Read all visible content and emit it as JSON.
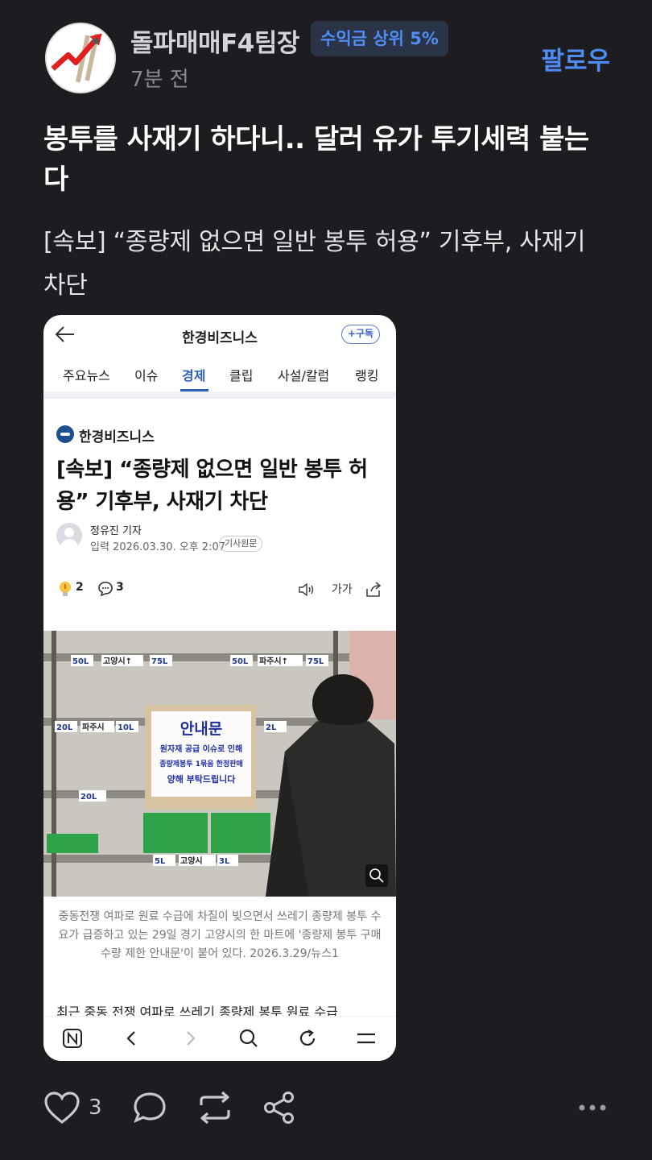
{
  "header": {
    "username": "돌파매매F4팀장",
    "badge": "수익금 상위 5%",
    "time_ago": "7분 전",
    "follow_label": "팔로우"
  },
  "post": {
    "title": "봉투를 사재기 하다니.. 달러 유가 투기세력 붙는다",
    "body": "[속보] “종량제 없으면 일반 봉투 허용” 기후부, 사재기 차단"
  },
  "embed": {
    "brand": "한경비즈니스",
    "subscribe": "+구독",
    "tabs": [
      "주요뉴스",
      "이슈",
      "경제",
      "클립",
      "사설/칼럼",
      "랭킹"
    ],
    "active_tab": "경제",
    "source": "한경비즈니스",
    "headline": "[속보] “종량제 없으면 일반 봉투 허용” 기후부, 사재기 차단",
    "reporter": "정유진 기자",
    "date": "입력 2026.03.30. 오후 2:07",
    "original_label": "기사원문",
    "reaction_count": "2",
    "comment_count": "3",
    "font_size_label": "가가",
    "photo_sign": {
      "title": "안내문",
      "line1": "원자재 공급 이슈로 인해",
      "line2": "종량제봉투 1묶음 한정판매",
      "line3": "양해 부탁드립니다",
      "shelf_labels": [
        "50L",
        "고양시↑",
        "75L",
        "50L",
        "파주시↑",
        "75L",
        "20L",
        "파주시",
        "10L",
        "2L",
        "20L",
        "5L",
        "고양시",
        "3L"
      ]
    },
    "caption": "중동전쟁 여파로 원료 수급에 차질이 빚으면서 쓰레기 종량제 봉투 수요가 급증하고 있는 29일 경기 고양시의 한 마트에 '종량제 봉투 구매 수량 제한 안내문'이 붙어 있다. 2026.3.29/뉴스1",
    "body_preview": "최근 중동 전쟁 여파로 쓰레기 종량제 봉투 원료 수급"
  },
  "footer": {
    "like_count": "3"
  },
  "colors": {
    "background": "#1c1c21",
    "accent": "#4f8df5",
    "badge_bg": "#2a3446",
    "active_tab": "#2e5fbf"
  }
}
